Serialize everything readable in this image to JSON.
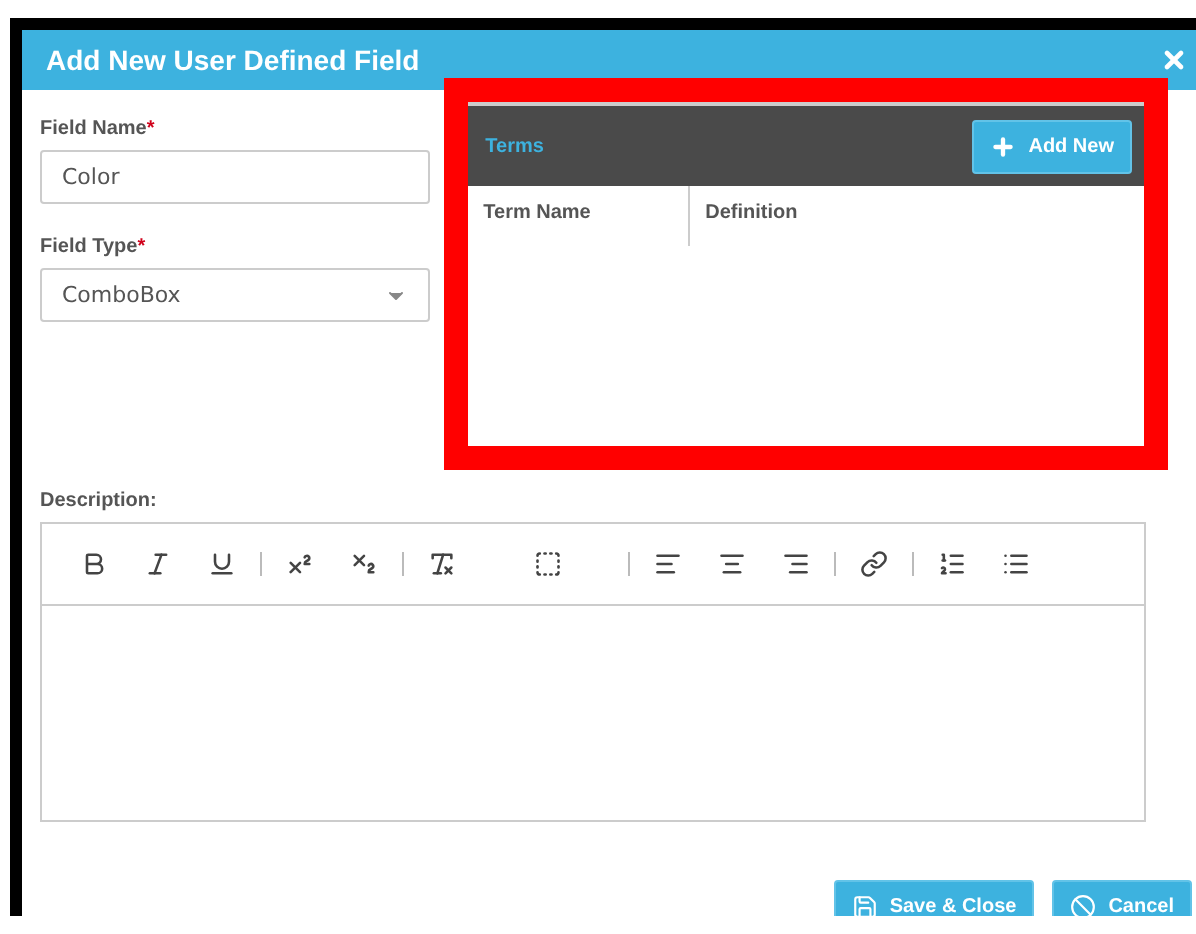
{
  "dialog": {
    "title": "Add New User Defined Field"
  },
  "fields": [
    {
      "label": "Field Name",
      "required_mark": "*",
      "kind": "text",
      "value": "Color"
    },
    {
      "label": "Field Type",
      "required_mark": "*",
      "kind": "select",
      "value": "ComboBox"
    }
  ],
  "terms": {
    "title": "Terms",
    "add_button": "Add New",
    "columns": [
      "Term Name",
      "Definition"
    ]
  },
  "description": {
    "label": "Description:"
  },
  "buttons": [
    {
      "label": "Save & Close",
      "kind": "save"
    },
    {
      "label": "Cancel",
      "kind": "cancel"
    }
  ]
}
